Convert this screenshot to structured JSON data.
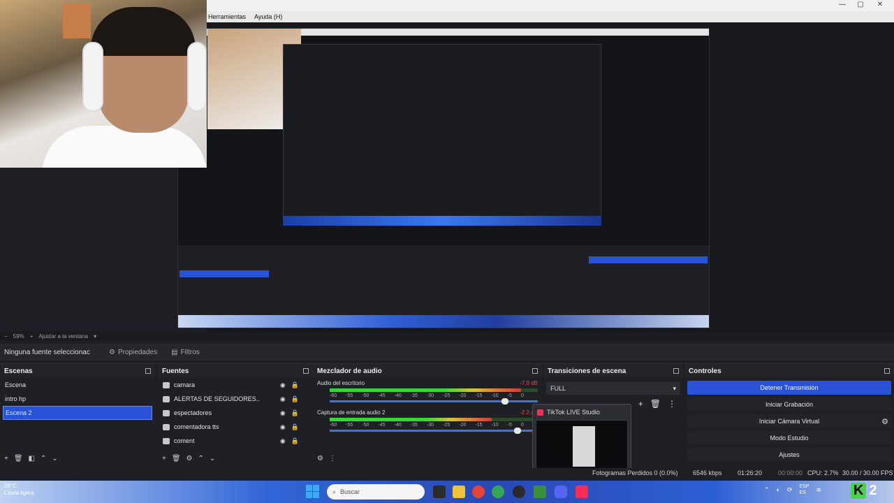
{
  "menu": {
    "tools": "Herramientas",
    "help": "Ayuda (H)"
  },
  "zoom": {
    "minus": "−",
    "percent": "59%",
    "plus": "+",
    "fit": "Ajustar a la ventana"
  },
  "source_bar": {
    "no_source": "Ninguna fuente seleccionac",
    "properties": "Propiedades",
    "filters": "Filtros"
  },
  "scenes": {
    "title": "Escenas",
    "items": [
      "Escena",
      "intro hp",
      "Escena 2"
    ],
    "selected": "Escena 2"
  },
  "sources": {
    "title": "Fuentes",
    "items": [
      "camara",
      "ALERTAS DE SEGUIDORES..",
      "espectadores",
      "comentadora tts",
      "coment"
    ]
  },
  "mixer": {
    "title": "Mezclador de audio",
    "channels": [
      {
        "name": "Audio del escritorio",
        "db": "-7.9 dB",
        "level": 0.92,
        "fader": 0.86
      },
      {
        "name": "Captura de entrada audio 2",
        "db": "-2.2 dB",
        "level": 0.78,
        "fader": 0.92
      }
    ],
    "scale": [
      "-60",
      "-55",
      "-50",
      "-45",
      "-40",
      "-35",
      "-30",
      "-25",
      "-20",
      "-15",
      "-10",
      "-5",
      "0"
    ]
  },
  "transitions": {
    "title": "Transiciones de escena",
    "selected": "FULL"
  },
  "controls": {
    "title": "Controles",
    "stop_stream": "Detener Transmisión",
    "start_record": "Iniciar Grabación",
    "start_vcam": "Iniciar Cámara Virtual",
    "studio_mode": "Modo Estudio",
    "settings": "Ajustes"
  },
  "tiktok": {
    "title": "TikTok LIVE Studio"
  },
  "status": {
    "dropped": "Fotogramas Perdidos 0 (0.0%)",
    "rec_time": "00:00:00",
    "bitrate": "6546 kbps",
    "live_time": "01:26:20",
    "cpu": "CPU: 2.7%",
    "fps": "30.00 / 30.00 FPS"
  },
  "taskbar": {
    "weather_temp": "26°C",
    "weather_desc": "Lluvia ligera",
    "search": "Buscar",
    "lang": "ESP",
    "region": "ES",
    "badge": "2"
  }
}
